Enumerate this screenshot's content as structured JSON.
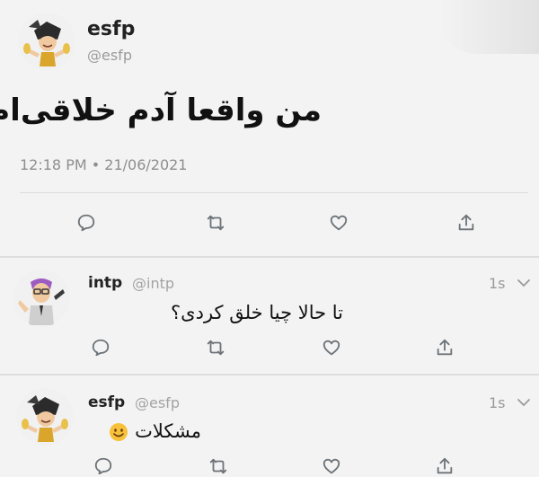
{
  "main_tweet": {
    "name": "esfp",
    "handle": "@esfp",
    "text": "من واقعا آدم خلاقی‌ام!",
    "timestamp": "12:18 PM • 21/06/2021",
    "avatar_icon": "esfp-character-avatar"
  },
  "replies": [
    {
      "name": "intp",
      "handle": "@intp",
      "age": "1s",
      "text": "تا حالا چیا خلق کردی؟",
      "avatar_icon": "intp-character-avatar"
    },
    {
      "name": "esfp",
      "handle": "@esfp",
      "age": "1s",
      "text": "مشکلات",
      "emoji": "smiling-face-emoji",
      "avatar_icon": "esfp-character-avatar"
    }
  ],
  "actions": [
    "reply-icon",
    "retweet-icon",
    "like-icon",
    "share-icon"
  ],
  "colors": {
    "background": "#f3f3f3",
    "muted_text": "#9b9b9b",
    "icon": "#6e7479",
    "divider": "#dcdcdc"
  }
}
